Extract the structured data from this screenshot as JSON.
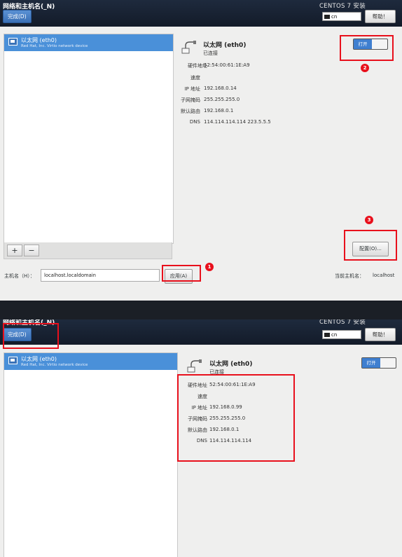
{
  "panel1": {
    "title": "网络和主机名(_N)",
    "product": "CENTOS 7 安装",
    "done_label": "完成(D)",
    "keyboard": "cn",
    "help_label": "帮助！",
    "device": {
      "name": "以太网 (eth0)",
      "description": "Red Hat, Inc. Virtio network device"
    },
    "interface": {
      "name": "以太网 (eth0)",
      "status": "已连接",
      "toggle": "打开"
    },
    "info_labels": {
      "hw": "硬件地址",
      "speed": "速度",
      "ip": "IP 地址",
      "mask": "子网掩码",
      "route": "默认路由",
      "dns": "DNS"
    },
    "info_values": {
      "hw": "52:54:00:61:1E:A9",
      "speed": "",
      "ip": "192.168.0.14",
      "mask": "255.255.255.0",
      "route": "192.168.0.1",
      "dns": "114.114.114.114 223.5.5.5"
    },
    "add_label": "+",
    "remove_label": "−",
    "config_label": "配置(O)...",
    "hostname_label": "主机名（H）：",
    "hostname_value": "localhost.localdomain",
    "apply_label": "应用(A)",
    "current_hostname_label": "当前主机名：",
    "current_hostname_value": "localhost",
    "markers": {
      "m1": "1",
      "m2": "2",
      "m3": "3"
    }
  },
  "panel2": {
    "title": "网络和主机名(_N)",
    "product": "CENTOS 7 安装",
    "done_label": "完成(D)",
    "keyboard": "cn",
    "help_label": "帮助！",
    "device": {
      "name": "以太网 (eth0)",
      "description": "Red Hat, Inc. Virtio network device"
    },
    "interface": {
      "name": "以太网 (eth0)",
      "status": "已连接",
      "toggle": "打开"
    },
    "info_labels": {
      "hw": "硬件地址",
      "speed": "速度",
      "ip": "IP 地址",
      "mask": "子网掩码",
      "route": "默认路由",
      "dns": "DNS"
    },
    "info_values": {
      "hw": "52:54:00:61:1E:A9",
      "speed": "",
      "ip": "192.168.0.99",
      "mask": "255.255.255.0",
      "route": "192.168.0.1",
      "dns": "114.114.114.114"
    }
  },
  "colors": {
    "accent": "#4a90d9",
    "highlight": "#e8101c",
    "header": "#18202e"
  }
}
